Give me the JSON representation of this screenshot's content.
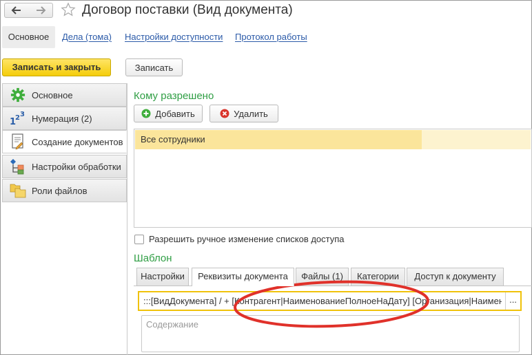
{
  "window": {
    "title": "Договор поставки (Вид документа)"
  },
  "section_tabs": [
    {
      "label": "Основное"
    },
    {
      "label": "Дела (тома)"
    },
    {
      "label": "Настройки доступности"
    },
    {
      "label": "Протокол работы"
    }
  ],
  "toolbar": {
    "save_close_label": "Записать и закрыть",
    "save_label": "Записать"
  },
  "left_nav": [
    {
      "label": "Основное",
      "icon": "gear-icon"
    },
    {
      "label": "Нумерация (2)",
      "icon": "numbering-icon"
    },
    {
      "label": "Создание документов",
      "icon": "document-icon"
    },
    {
      "label": "Настройки обработки",
      "icon": "process-icon"
    },
    {
      "label": "Роли файлов",
      "icon": "folders-icon"
    }
  ],
  "access": {
    "title": "Кому разрешено",
    "add_label": "Добавить",
    "delete_label": "Удалить",
    "rows": [
      "Все сотрудники"
    ],
    "manual_change_label": "Разрешить ручное изменение списков доступа"
  },
  "template": {
    "title": "Шаблон",
    "tabs": [
      {
        "label": "Настройки"
      },
      {
        "label": "Реквизиты документа"
      },
      {
        "label": "Файлы (1)"
      },
      {
        "label": "Категории"
      },
      {
        "label": "Доступ к документу"
      }
    ],
    "value": ":::[ВидДокумента] / + [Контрагент|НаименованиеПолноеНаДату] [Организация|Наименование]",
    "dots_label": "...",
    "content_placeholder": "Содержание"
  },
  "colors": {
    "accent_green": "#2f9e44",
    "link_blue": "#2b5aa8",
    "primary_yellow": "#f4cd0a",
    "selection_yellow": "#fbe59b",
    "annotation_red": "#e0312a"
  }
}
